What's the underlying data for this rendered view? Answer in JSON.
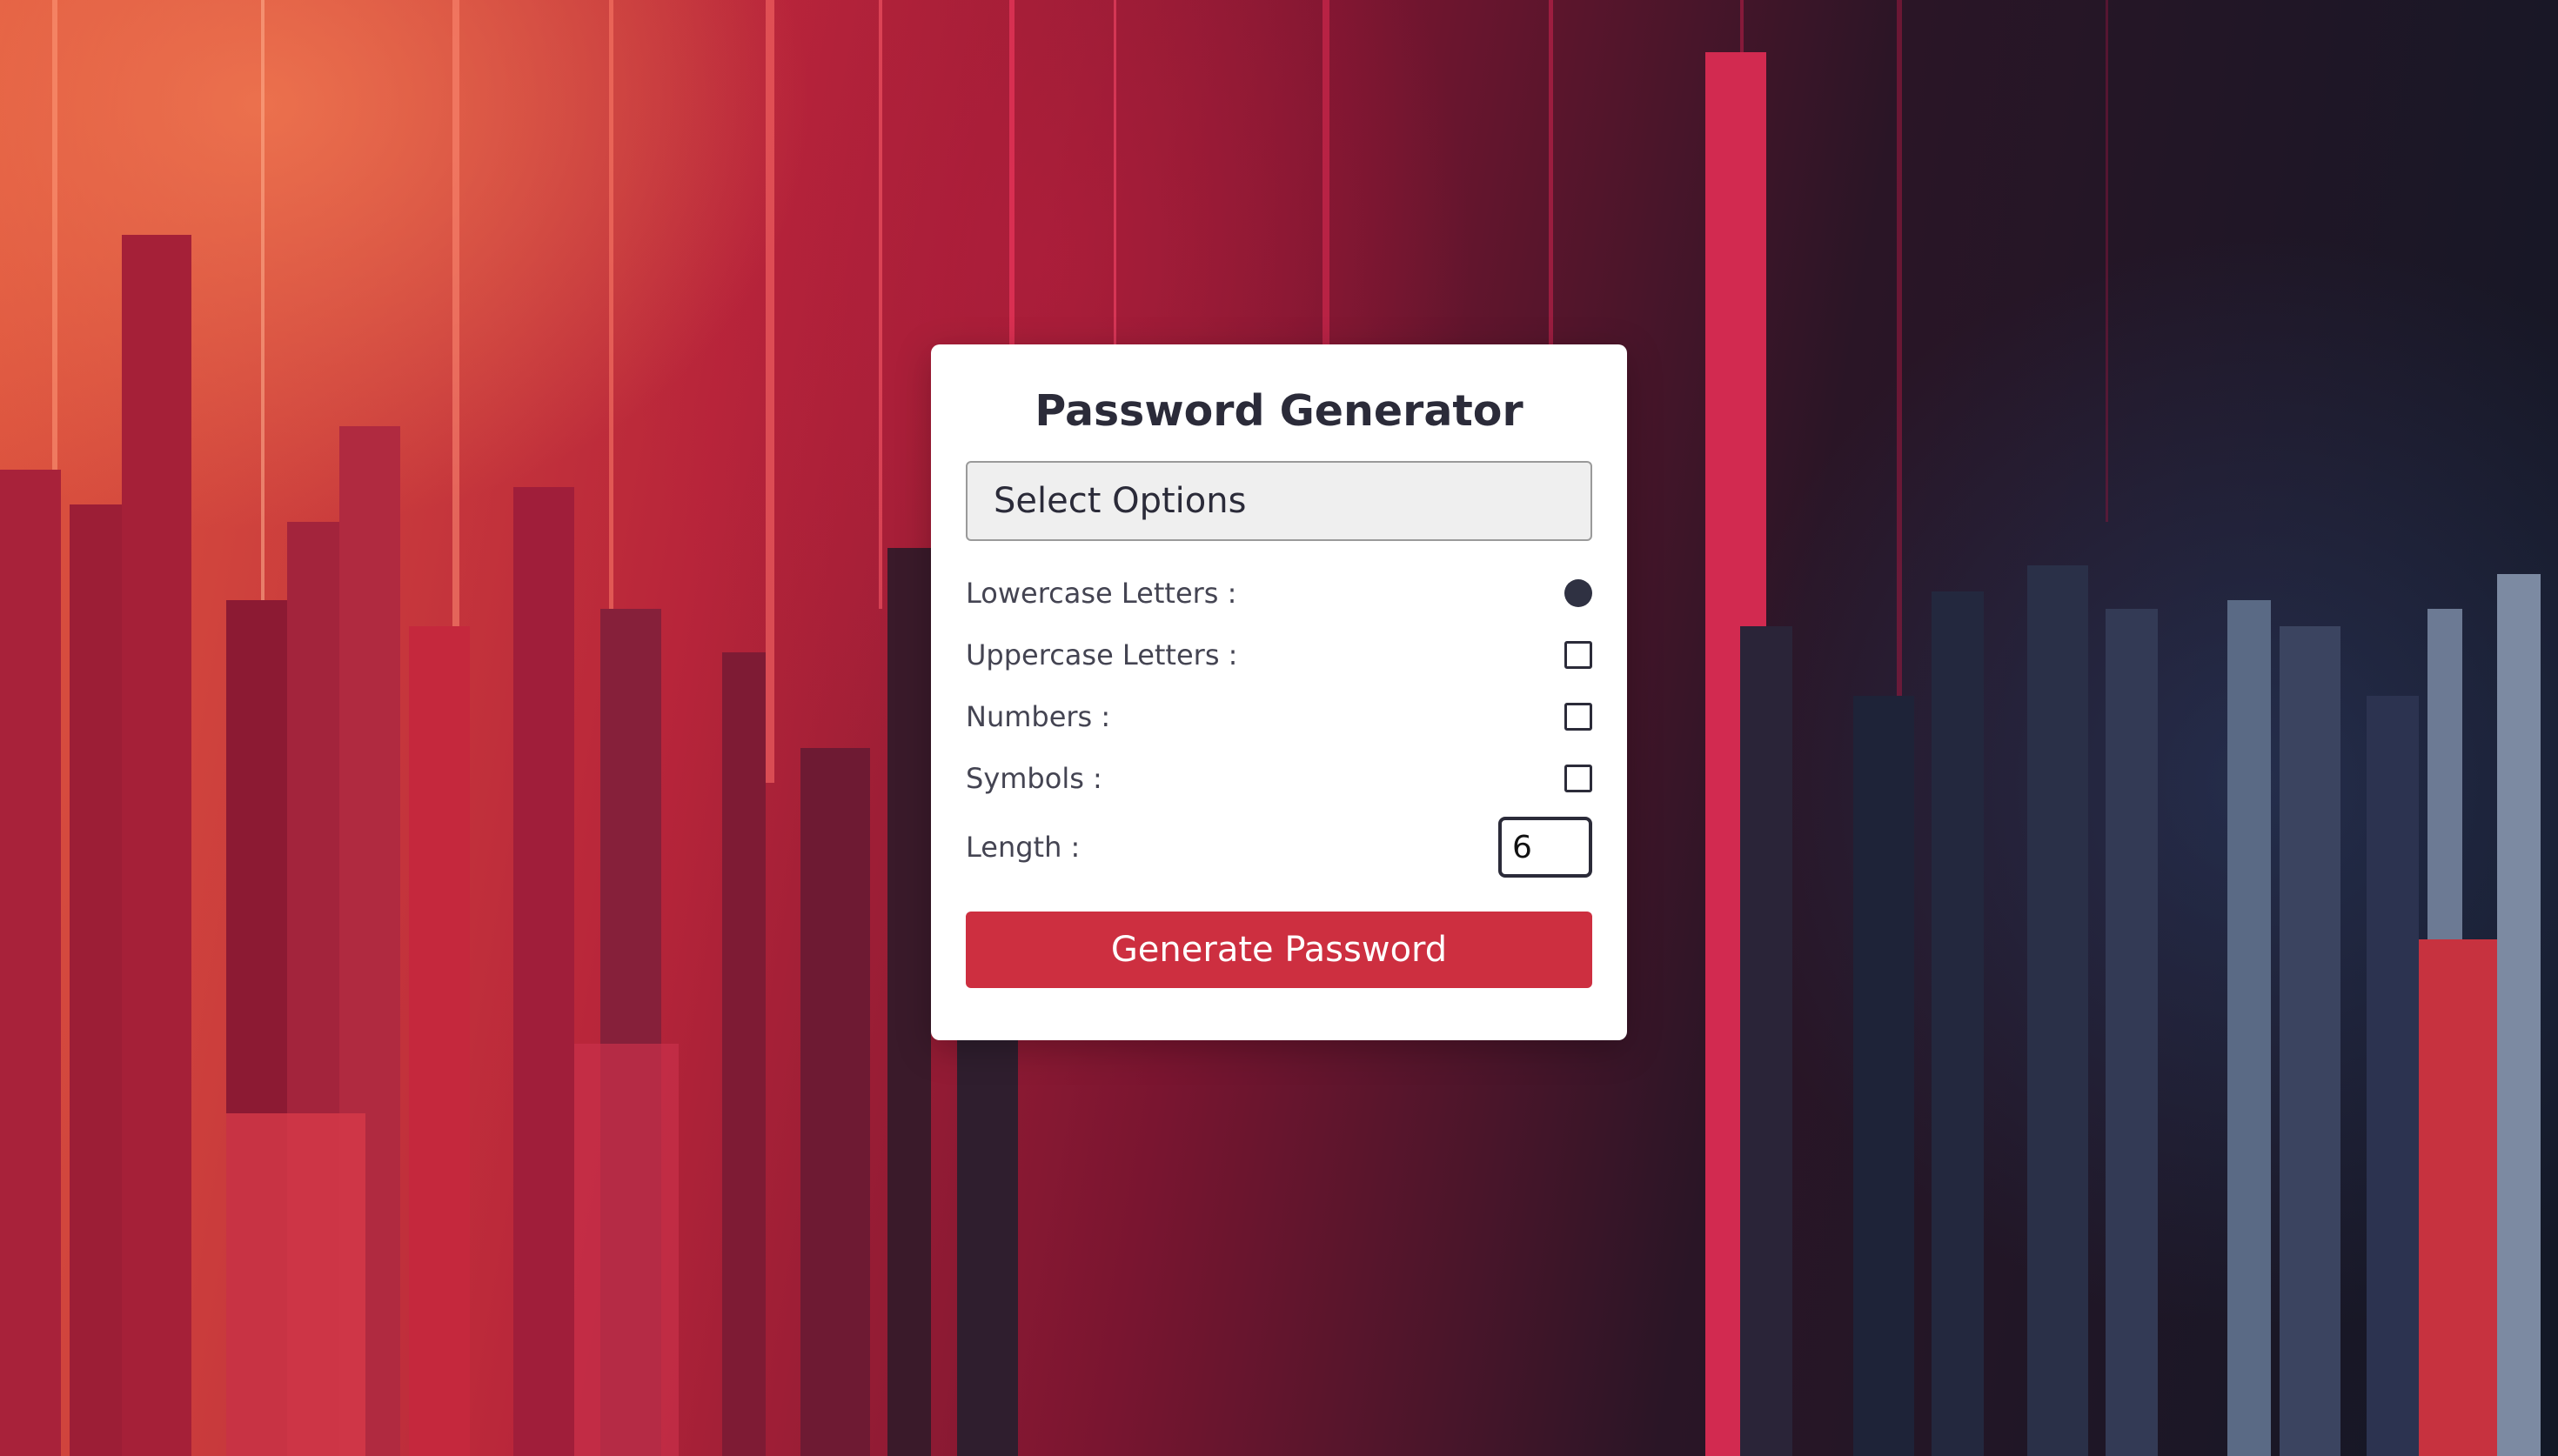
{
  "app": {
    "title": "Password Generator"
  },
  "options_dropdown": {
    "selected": "Select Options"
  },
  "options": [
    {
      "label": "Lowercase Letters :",
      "control": "radio",
      "checked": true
    },
    {
      "label": "Uppercase Letters :",
      "control": "checkbox",
      "checked": false
    },
    {
      "label": "Numbers :",
      "control": "checkbox",
      "checked": false
    },
    {
      "label": "Symbols :",
      "control": "checkbox",
      "checked": false
    }
  ],
  "length": {
    "label": "Length :",
    "value": "6"
  },
  "generate_button": {
    "label": "Generate Password"
  },
  "colors": {
    "accent": "#cd2f40",
    "title_text": "#2b2b39",
    "card_bg": "#ffffff"
  }
}
